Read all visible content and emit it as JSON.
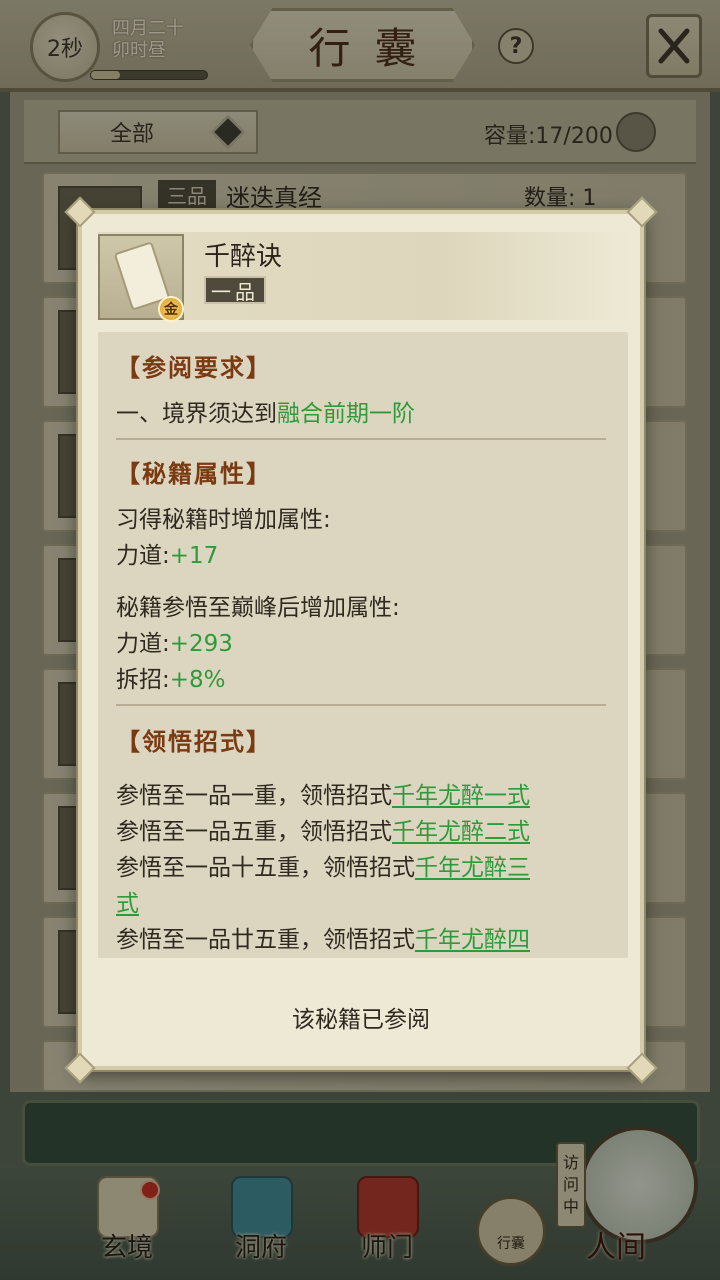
{
  "header": {
    "timer": "2秒",
    "date_line1": "四月二十",
    "date_line2": "卯时昼",
    "progress": 0.25,
    "title": "行囊",
    "help_label": "?"
  },
  "filter": {
    "selected": "全部",
    "capacity": "容量:17/200"
  },
  "list": {
    "first_row": {
      "grade": "三品",
      "name": "迷迭真经",
      "quantity": "数量: 1"
    }
  },
  "modal": {
    "item_name": "千醉诀",
    "item_grade": "一品",
    "badge": "金",
    "section_requirement": "【参阅要求】",
    "requirement_prefix": "一、境界须达到",
    "requirement_value": "融合前期一阶",
    "section_attributes": "【秘籍属性】",
    "learn_bonus_label": "习得秘籍时增加属性:",
    "learn_bonus": [
      {
        "name": "力道:",
        "value": "+17"
      }
    ],
    "peak_bonus_label": "秘籍参悟至巅峰后增加属性:",
    "peak_bonus": [
      {
        "name": "力道:",
        "value": "+293"
      },
      {
        "name": "拆招:",
        "value": "+8%"
      }
    ],
    "section_moves": "【领悟招式】",
    "moves": [
      {
        "prefix": "参悟至一品一重，领悟招式",
        "move": "千年尤醉一式"
      },
      {
        "prefix": "参悟至一品五重，领悟招式",
        "move": "千年尤醉二式"
      },
      {
        "prefix": "参悟至一品十五重，领悟招式",
        "move": "千年尤醉三",
        "move_wrap": "式"
      },
      {
        "prefix": "参悟至一品廿五重，领悟招式",
        "move": "千年尤醉四"
      }
    ],
    "footer": "该秘籍已参阅"
  },
  "nav": {
    "items": [
      "玄境",
      "洞府",
      "师门"
    ],
    "bag": "行囊",
    "visiting": "访问中",
    "world": "人间"
  }
}
